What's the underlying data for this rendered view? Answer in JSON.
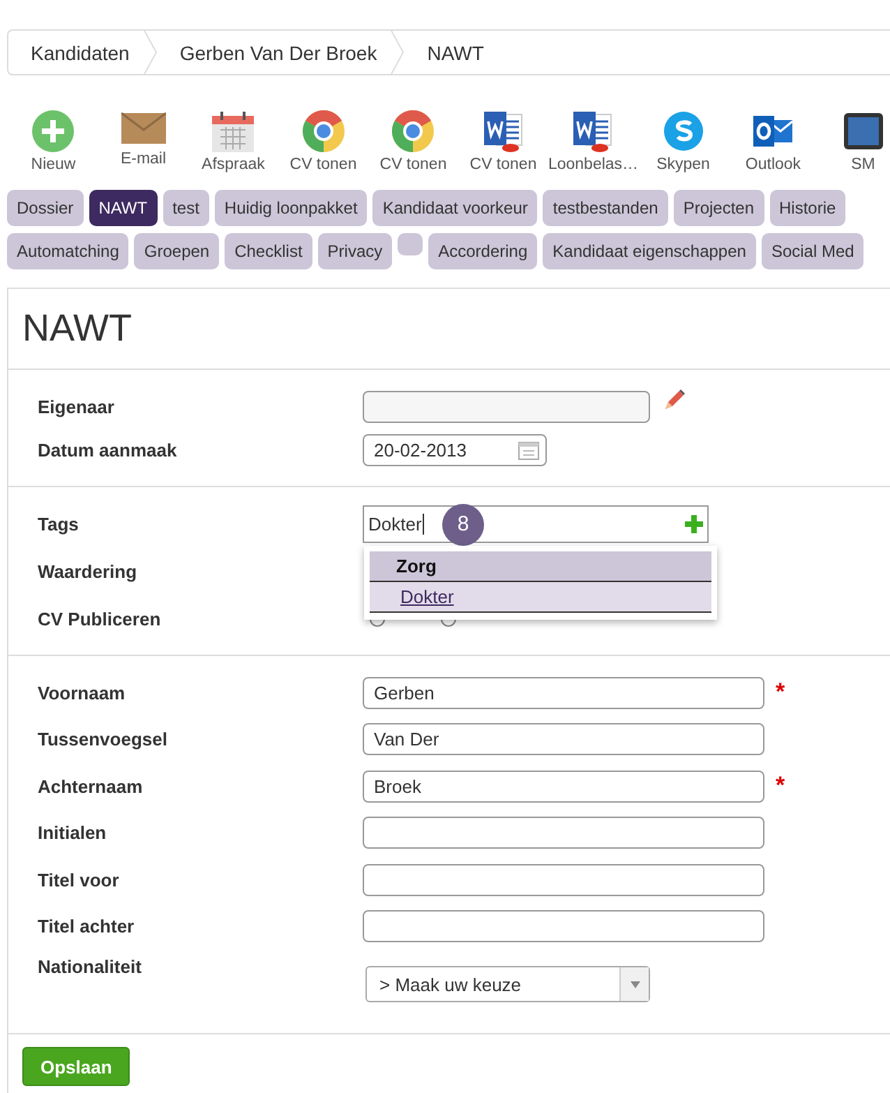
{
  "breadcrumb": [
    {
      "label": "Kandidaten"
    },
    {
      "label": "Gerben Van Der Broek"
    },
    {
      "label": "NAWT"
    }
  ],
  "toolbar": [
    {
      "kind": "add",
      "label": "Nieuw"
    },
    {
      "kind": "mail",
      "label": "E-mail"
    },
    {
      "kind": "calendar",
      "label": "Afspraak"
    },
    {
      "kind": "chrome",
      "label": "CV tonen"
    },
    {
      "kind": "chrome",
      "label": "CV tonen"
    },
    {
      "kind": "word",
      "label": "CV tonen"
    },
    {
      "kind": "word",
      "label": "Loonbelas…"
    },
    {
      "kind": "skype",
      "label": "Skypen"
    },
    {
      "kind": "outlook",
      "label": "Outlook"
    },
    {
      "kind": "tablet",
      "label": "SM"
    }
  ],
  "tab_rows": [
    [
      {
        "label": "Dossier",
        "selected": false
      },
      {
        "label": "NAWT",
        "selected": true
      },
      {
        "label": "test",
        "selected": false
      },
      {
        "label": "Huidig loonpakket",
        "selected": false
      },
      {
        "label": "Kandidaat voorkeur",
        "selected": false
      },
      {
        "label": "testbestanden",
        "selected": false
      },
      {
        "label": "Projecten",
        "selected": false
      },
      {
        "label": "Historie",
        "selected": false
      }
    ],
    [
      {
        "label": "Automatching",
        "selected": false
      },
      {
        "label": "Groepen",
        "selected": false
      },
      {
        "label": "Checklist",
        "selected": false
      },
      {
        "label": "Privacy",
        "selected": false
      },
      {
        "selected": false
      },
      {
        "label": "Accordering",
        "selected": false
      },
      {
        "label": "Kandidaat eigenschappen",
        "selected": false
      },
      {
        "label": "Social Med",
        "selected": false
      }
    ]
  ],
  "page_title": "NAWT",
  "sections": [
    [
      {
        "kind": "owner",
        "label": "Eigenaar"
      },
      {
        "kind": "date",
        "label": "Datum aanmaak",
        "value": "20-02-2013"
      }
    ],
    [
      {
        "kind": "tags",
        "label": "Tags",
        "value": "Dokter",
        "badge": "8",
        "suggestions": {
          "group": "Zorg",
          "items": [
            {
              "label": "Dokter",
              "selected": true
            }
          ]
        }
      },
      {
        "kind": "plain",
        "label": "Waardering"
      },
      {
        "kind": "radio",
        "label": "CV Publiceren",
        "options": [
          {
            "selected": false
          },
          {
            "selected": false
          }
        ]
      }
    ],
    [
      {
        "kind": "text",
        "label": "Voornaam",
        "value": "Gerben",
        "marker": "*"
      },
      {
        "kind": "text",
        "label": "Tussenvoegsel",
        "value": "Van Der"
      },
      {
        "kind": "text",
        "label": "Achternaam",
        "value": "Broek",
        "marker": "*"
      },
      {
        "kind": "text",
        "label": "Initialen"
      },
      {
        "kind": "text",
        "label": "Titel voor"
      },
      {
        "kind": "text",
        "label": "Titel achter"
      },
      {
        "kind": "select",
        "label": "Nationaliteit",
        "value": "> Maak uw keuze"
      }
    ]
  ],
  "save_button": "Opslaan"
}
